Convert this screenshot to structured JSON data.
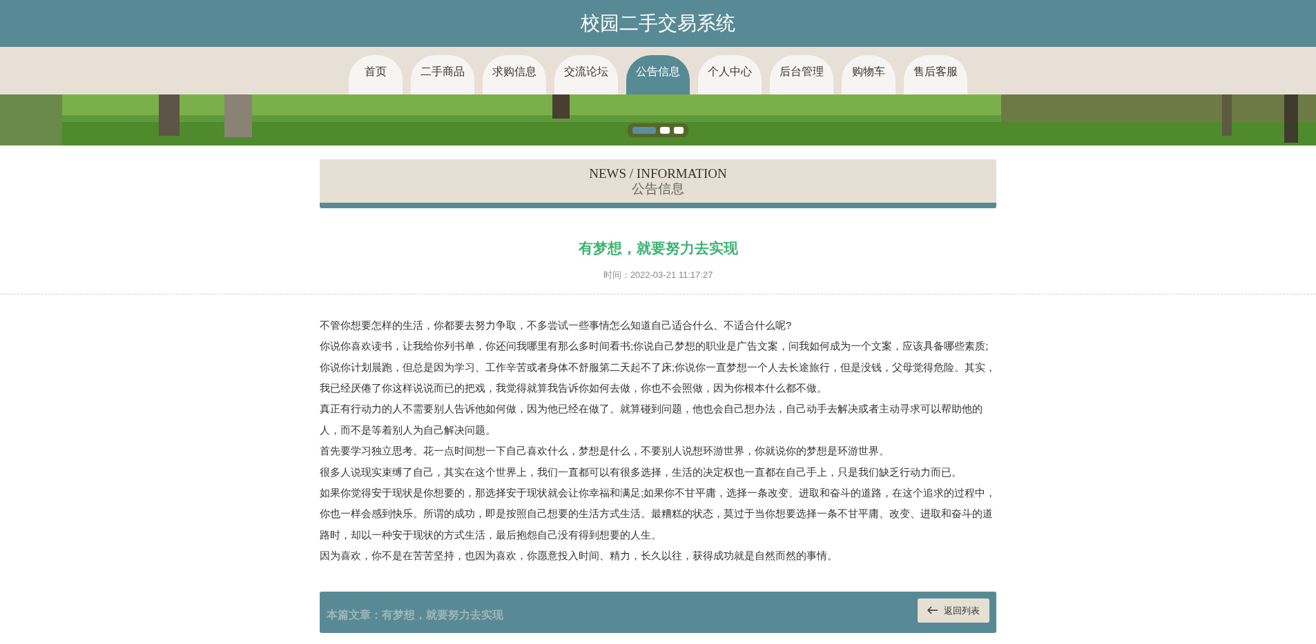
{
  "site_title": "校园二手交易系统",
  "nav": [
    {
      "label": "首页",
      "selected": false
    },
    {
      "label": "二手商品",
      "selected": false
    },
    {
      "label": "求购信息",
      "selected": false
    },
    {
      "label": "交流论坛",
      "selected": false
    },
    {
      "label": "公告信息",
      "selected": true
    },
    {
      "label": "个人中心",
      "selected": false
    },
    {
      "label": "后台管理",
      "selected": false
    },
    {
      "label": "购物车",
      "selected": false
    },
    {
      "label": "售后客服",
      "selected": false
    }
  ],
  "banner": {
    "kind": "picture",
    "slides": [
      {
        "selected": true
      },
      {
        "selected": false
      },
      {
        "selected": false
      }
    ]
  },
  "section": {
    "title_en": "NEWS / INFORMATION",
    "title": "公告信息"
  },
  "article": {
    "title": "有梦想，就要努力去实现",
    "time": "时间：2022-03-21 11:17:27",
    "paragraphs": [
      "不管你想要怎样的生活，你都要去努力争取，不多尝试一些事情怎么知道自己适合什么、不适合什么呢?",
      "你说你喜欢读书，让我给你列书单，你还问我哪里有那么多时间看书;你说自己梦想的职业是广告文案，问我如何成为一个文案，应该具备哪些素质;你说你计划晨跑，但总是因为学习、工作辛苦或者身体不舒服第二天起不了床;你说你一直梦想一个人去长途旅行，但是没钱，父母觉得危险。其实，我已经厌倦了你这样说说而已的把戏，我觉得就算我告诉你如何去做，你也不会照做，因为你根本什么都不做。",
      "真正有行动力的人不需要别人告诉他如何做，因为他已经在做了。就算碰到问题，他也会自己想办法，自己动手去解决或者主动寻求可以帮助他的人，而不是等着别人为自己解决问题。",
      "首先要学习独立思考。花一点时间想一下自己喜欢什么，梦想是什么，不要别人说想环游世界，你就说你的梦想是环游世界。",
      "很多人说现实束缚了自己，其实在这个世界上，我们一直都可以有很多选择，生活的决定权也一直都在自己手上，只是我们缺乏行动力而已。",
      "如果你觉得安于现状是你想要的，那选择安于现状就会让你幸福和满足;如果你不甘平庸，选择一条改变、进取和奋斗的道路，在这个追求的过程中，你也一样会感到快乐。所谓的成功，即是按照自己想要的生活方式生活。最糟糕的状态，莫过于当你想要选择一条不甘平庸、改变、进取和奋斗的道路时，却以一种安于现状的方式生活，最后抱怨自己没有得到想要的人生。",
      "因为喜欢，你不是在苦苦坚持，也因为喜欢，你愿意投入时间、精力，长久以往，获得成功就是自然而然的事情。"
    ]
  },
  "footer_bar": {
    "current": "本篇文章：有梦想，就要努力去实现",
    "back_button": "返回列表"
  }
}
